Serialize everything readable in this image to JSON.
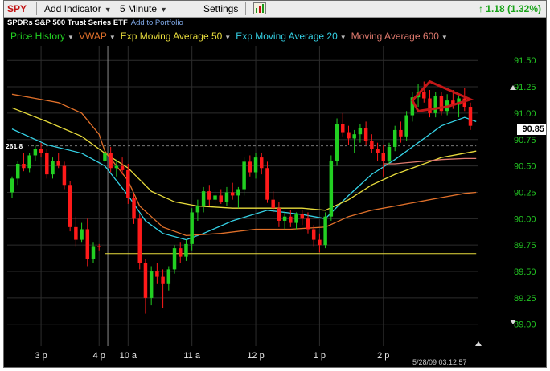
{
  "toolbar": {
    "symbol": "SPY",
    "add_indicator": "Add Indicator",
    "interval": "5 Minute",
    "settings": "Settings",
    "change": "1.18 (1.32%)",
    "change_arrow_icon": "up-arrow-icon"
  },
  "subtitle": {
    "name": "SPDRs S&P 500 Trust Series ETF",
    "add_to_portfolio": "Add to Portfolio"
  },
  "indicators": [
    {
      "label": "Price History",
      "color": "#22d022"
    },
    {
      "label": "VWAP",
      "color": "#e0702a"
    },
    {
      "label": "Exp Moving Average 50",
      "color": "#e8dc3c"
    },
    {
      "label": "Exp Moving Average 20",
      "color": "#35d2e6"
    },
    {
      "label": "Moving Average 600",
      "color": "#e07a6e"
    }
  ],
  "colors": {
    "background": "#000000",
    "grid": "#2d2d2d",
    "up": "#22d022",
    "down": "#ff1a1a",
    "wedge": "#c41818",
    "axis_text": "#23c823"
  },
  "readouts": {
    "last_price": "90.85",
    "left_value": "261.8",
    "timestamp": "5/28/09 03:12:57"
  },
  "chart_data": {
    "type": "candlestick",
    "y_ticks": [
      "91.50",
      "91.25",
      "91.00",
      "90.75",
      "90.50",
      "90.25",
      "90.00",
      "89.75",
      "89.50",
      "89.25",
      "89.00"
    ],
    "ylim": [
      88.96,
      91.57
    ],
    "x_ticks": [
      {
        "label": "3 p",
        "i": 5
      },
      {
        "label": "4 p",
        "i": 15
      },
      {
        "label": "10 a",
        "i": 20
      },
      {
        "label": "11 a",
        "i": 31
      },
      {
        "label": "12 p",
        "i": 42
      },
      {
        "label": "1 p",
        "i": 53
      },
      {
        "label": "2 p",
        "i": 64
      }
    ],
    "session_break_i": 16.5,
    "candles": [
      [
        90.25,
        90.4,
        90.2,
        90.38
      ],
      [
        90.38,
        90.55,
        90.32,
        90.52
      ],
      [
        90.52,
        90.62,
        90.45,
        90.48
      ],
      [
        90.48,
        90.62,
        90.44,
        90.6
      ],
      [
        90.6,
        90.7,
        90.55,
        90.66
      ],
      [
        90.66,
        90.72,
        90.58,
        90.62
      ],
      [
        90.62,
        90.66,
        90.38,
        90.42
      ],
      [
        90.42,
        90.58,
        90.38,
        90.55
      ],
      [
        90.55,
        90.62,
        90.48,
        90.5
      ],
      [
        90.5,
        90.54,
        90.28,
        90.32
      ],
      [
        90.32,
        90.36,
        89.88,
        89.92
      ],
      [
        89.92,
        90.02,
        89.74,
        89.8
      ],
      [
        89.8,
        89.96,
        89.78,
        89.9
      ],
      [
        89.9,
        90.0,
        89.55,
        89.62
      ],
      [
        89.62,
        89.78,
        89.58,
        89.74
      ],
      [
        89.74,
        89.76,
        89.7,
        89.73
      ],
      [
        90.55,
        90.7,
        90.48,
        90.62
      ],
      [
        90.62,
        90.68,
        90.44,
        90.48
      ],
      [
        90.48,
        90.56,
        90.4,
        90.5
      ],
      [
        90.5,
        90.58,
        90.42,
        90.46
      ],
      [
        90.46,
        90.52,
        90.14,
        90.2
      ],
      [
        90.2,
        90.24,
        89.95,
        90.0
      ],
      [
        90.0,
        90.04,
        89.52,
        89.58
      ],
      [
        89.58,
        89.62,
        89.1,
        89.25
      ],
      [
        89.25,
        89.55,
        89.18,
        89.5
      ],
      [
        89.5,
        89.58,
        89.38,
        89.45
      ],
      [
        89.45,
        89.52,
        89.15,
        89.38
      ],
      [
        89.38,
        89.55,
        89.32,
        89.52
      ],
      [
        89.52,
        89.75,
        89.48,
        89.72
      ],
      [
        89.72,
        89.78,
        89.58,
        89.64
      ],
      [
        89.64,
        89.8,
        89.6,
        89.76
      ],
      [
        89.76,
        90.1,
        89.7,
        90.06
      ],
      [
        90.06,
        90.18,
        89.98,
        90.12
      ],
      [
        90.12,
        90.3,
        90.06,
        90.26
      ],
      [
        90.26,
        90.32,
        90.12,
        90.18
      ],
      [
        90.18,
        90.26,
        90.08,
        90.22
      ],
      [
        90.22,
        90.28,
        90.14,
        90.16
      ],
      [
        90.16,
        90.3,
        90.12,
        90.25
      ],
      [
        90.25,
        90.34,
        90.18,
        90.22
      ],
      [
        90.22,
        90.3,
        90.1,
        90.28
      ],
      [
        90.28,
        90.58,
        90.22,
        90.54
      ],
      [
        90.54,
        90.6,
        90.4,
        90.44
      ],
      [
        90.44,
        90.62,
        90.38,
        90.58
      ],
      [
        90.58,
        90.62,
        90.42,
        90.48
      ],
      [
        90.48,
        90.54,
        90.15,
        90.18
      ],
      [
        90.18,
        90.26,
        90.06,
        90.1
      ],
      [
        90.1,
        90.16,
        89.92,
        89.98
      ],
      [
        89.98,
        90.06,
        89.9,
        90.02
      ],
      [
        90.02,
        90.08,
        89.92,
        89.96
      ],
      [
        89.96,
        90.06,
        89.9,
        90.04
      ],
      [
        90.04,
        90.08,
        89.94,
        90.0
      ],
      [
        90.0,
        90.06,
        89.86,
        89.9
      ],
      [
        89.9,
        89.94,
        89.74,
        89.8
      ],
      [
        89.8,
        89.86,
        89.68,
        89.75
      ],
      [
        89.75,
        90.06,
        89.72,
        90.02
      ],
      [
        90.02,
        90.6,
        89.98,
        90.55
      ],
      [
        90.55,
        90.95,
        90.5,
        90.9
      ],
      [
        90.9,
        91.0,
        90.78,
        90.82
      ],
      [
        90.82,
        90.88,
        90.7,
        90.76
      ],
      [
        90.76,
        90.84,
        90.62,
        90.8
      ],
      [
        90.8,
        90.9,
        90.72,
        90.86
      ],
      [
        90.86,
        90.92,
        90.7,
        90.74
      ],
      [
        90.74,
        90.8,
        90.62,
        90.66
      ],
      [
        90.66,
        90.72,
        90.55,
        90.62
      ],
      [
        90.62,
        90.7,
        90.4,
        90.55
      ],
      [
        90.55,
        90.72,
        90.52,
        90.68
      ],
      [
        90.68,
        90.88,
        90.64,
        90.84
      ],
      [
        90.84,
        90.92,
        90.72,
        90.78
      ],
      [
        90.78,
        91.02,
        90.74,
        90.98
      ],
      [
        90.98,
        91.2,
        90.92,
        91.15
      ],
      [
        91.15,
        91.28,
        91.06,
        91.2
      ],
      [
        91.2,
        91.3,
        91.1,
        91.14
      ],
      [
        91.14,
        91.22,
        90.96,
        91.0
      ],
      [
        91.0,
        91.2,
        90.96,
        91.16
      ],
      [
        91.16,
        91.2,
        90.98,
        91.02
      ],
      [
        91.02,
        91.18,
        90.98,
        91.12
      ],
      [
        91.12,
        91.22,
        91.04,
        91.08
      ],
      [
        91.08,
        91.16,
        90.96,
        91.14
      ],
      [
        91.14,
        91.24,
        91.02,
        91.06
      ],
      [
        91.06,
        91.1,
        90.84,
        90.88
      ]
    ],
    "series": [
      {
        "name": "Exp Moving Average 20",
        "color": "#35d2e6",
        "points": [
          [
            0,
            90.85
          ],
          [
            6,
            90.7
          ],
          [
            12,
            90.62
          ],
          [
            16,
            90.5
          ],
          [
            20,
            90.22
          ],
          [
            23,
            89.98
          ],
          [
            26,
            89.86
          ],
          [
            30,
            89.8
          ],
          [
            33,
            89.86
          ],
          [
            38,
            89.98
          ],
          [
            44,
            90.08
          ],
          [
            50,
            90.04
          ],
          [
            54,
            90.0
          ],
          [
            58,
            90.22
          ],
          [
            62,
            90.42
          ],
          [
            66,
            90.56
          ],
          [
            70,
            90.72
          ],
          [
            74,
            90.88
          ],
          [
            78,
            90.96
          ],
          [
            80,
            90.92
          ]
        ]
      },
      {
        "name": "Exp Moving Average 50",
        "color": "#e8dc3c",
        "points": [
          [
            0,
            91.05
          ],
          [
            6,
            90.92
          ],
          [
            12,
            90.78
          ],
          [
            16,
            90.62
          ],
          [
            20,
            90.48
          ],
          [
            24,
            90.26
          ],
          [
            28,
            90.16
          ],
          [
            32,
            90.12
          ],
          [
            38,
            90.1
          ],
          [
            44,
            90.1
          ],
          [
            50,
            90.1
          ],
          [
            54,
            90.08
          ],
          [
            58,
            90.18
          ],
          [
            62,
            90.32
          ],
          [
            66,
            90.42
          ],
          [
            70,
            90.5
          ],
          [
            74,
            90.58
          ],
          [
            78,
            90.62
          ],
          [
            80,
            90.64
          ]
        ]
      },
      {
        "name": "VWAP",
        "color": "#e0702a",
        "points": [
          [
            0,
            91.18
          ],
          [
            4,
            91.14
          ],
          [
            8,
            91.1
          ],
          [
            12,
            91.0
          ],
          [
            15,
            90.8
          ],
          [
            16,
            90.64
          ],
          [
            20,
            90.36
          ],
          [
            22,
            90.12
          ],
          [
            26,
            89.92
          ],
          [
            30,
            89.84
          ],
          [
            36,
            89.86
          ],
          [
            42,
            89.9
          ],
          [
            48,
            89.9
          ],
          [
            54,
            89.92
          ],
          [
            58,
            90.02
          ],
          [
            62,
            90.08
          ],
          [
            66,
            90.12
          ],
          [
            70,
            90.16
          ],
          [
            74,
            90.2
          ],
          [
            78,
            90.24
          ],
          [
            80,
            90.25
          ]
        ]
      },
      {
        "name": "Moving Average 600",
        "color": "#e07a6e",
        "points": [
          [
            64,
            90.52
          ],
          [
            66,
            90.52
          ],
          [
            70,
            90.54
          ],
          [
            74,
            90.56
          ],
          [
            78,
            90.57
          ],
          [
            80,
            90.57
          ]
        ]
      }
    ],
    "reference_lines": [
      {
        "name": "support",
        "color": "#e8dc3c",
        "y": 89.67,
        "from_i": 16,
        "to_i": 80
      },
      {
        "name": "dotted-level",
        "color": "#777777",
        "y": 90.69,
        "from_i": 0,
        "to_i": 80,
        "dashed": true
      }
    ],
    "wedge": [
      [
        69,
        91.12
      ],
      [
        72,
        91.3
      ],
      [
        79,
        91.13
      ],
      [
        75,
        91.06
      ],
      [
        70,
        91.02
      ]
    ],
    "grid": true,
    "legend_position": "top-left"
  }
}
